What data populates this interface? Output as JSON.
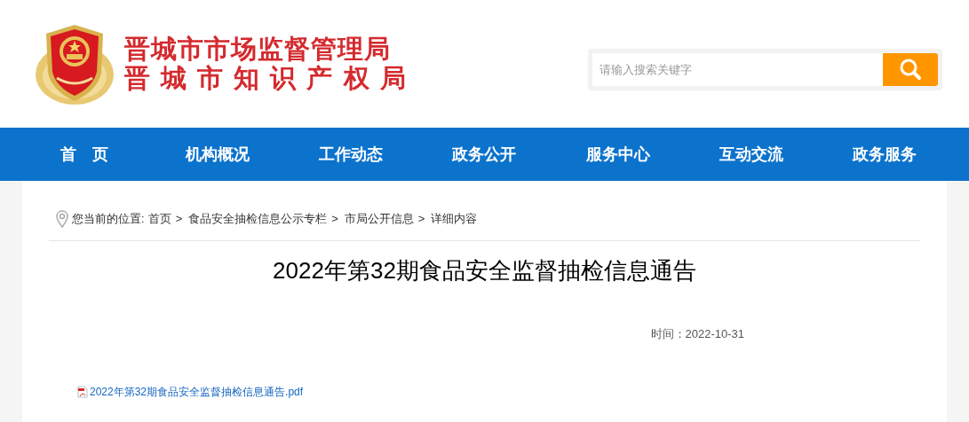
{
  "header": {
    "title_lines": [
      "晋城市市场监督管理局",
      "晋 城 市 知 识 产 权 局"
    ],
    "search": {
      "placeholder": "请输入搜索关键字"
    }
  },
  "nav": {
    "items": [
      {
        "label": "首　页",
        "selected": false
      },
      {
        "label": "机构概况",
        "selected": false
      },
      {
        "label": "工作动态",
        "selected": false
      },
      {
        "label": "政务公开",
        "selected": false
      },
      {
        "label": "服务中心",
        "selected": false
      },
      {
        "label": "互动交流",
        "selected": false
      },
      {
        "label": "政务服务",
        "selected": false
      }
    ]
  },
  "breadcrumb": {
    "label": "您当前的位置:",
    "separator": ">",
    "items": [
      "首页",
      "食品安全抽检信息公示专栏",
      "市局公开信息",
      "详细内容"
    ]
  },
  "article": {
    "title": "2022年第32期食品安全监督抽检信息通告",
    "time": "时间：2022-10-31",
    "attachment": "2022年第32期食品安全监督抽检信息通告.pdf"
  }
}
